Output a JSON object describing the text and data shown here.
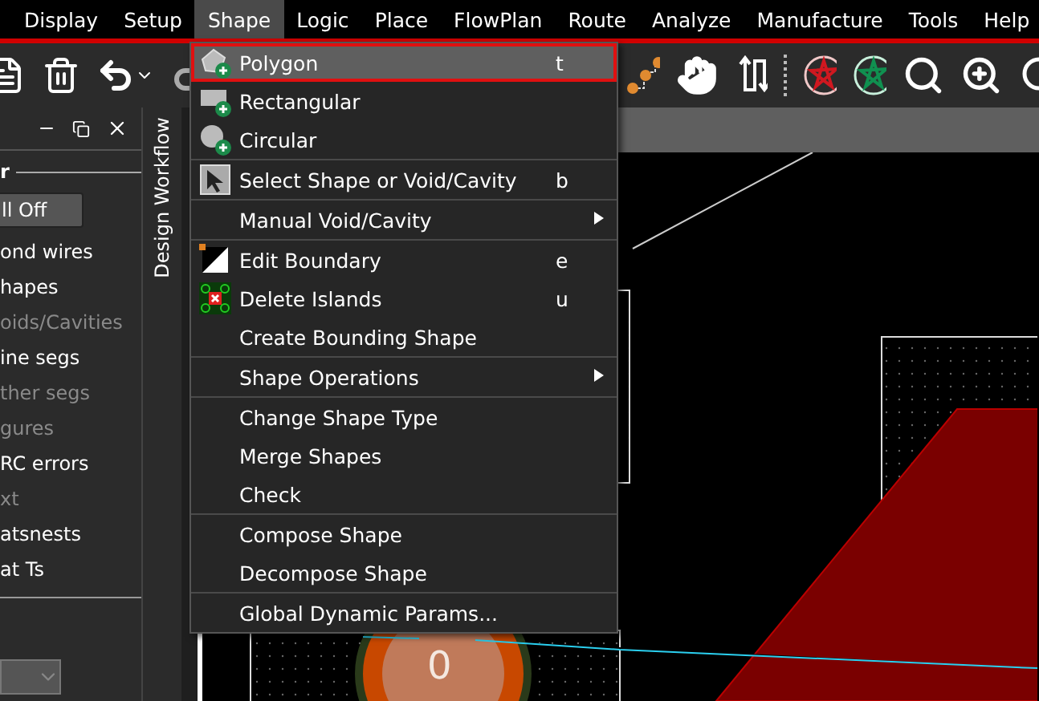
{
  "menubar": [
    {
      "label": "Display",
      "selected": false
    },
    {
      "label": "Setup",
      "selected": false
    },
    {
      "label": "Shape",
      "selected": true
    },
    {
      "label": "Logic",
      "selected": false
    },
    {
      "label": "Place",
      "selected": false
    },
    {
      "label": "FlowPlan",
      "selected": false
    },
    {
      "label": "Route",
      "selected": false
    },
    {
      "label": "Analyze",
      "selected": false
    },
    {
      "label": "Manufacture",
      "selected": false
    },
    {
      "label": "Tools",
      "selected": false
    },
    {
      "label": "Help",
      "selected": false
    }
  ],
  "side_panel": {
    "header": "r",
    "all_off_button": "ll Off",
    "items": [
      {
        "label": "ond wires",
        "enabled": true
      },
      {
        "label": "hapes",
        "enabled": true
      },
      {
        "label": "oids/Cavities",
        "enabled": false
      },
      {
        "label": "ine segs",
        "enabled": true
      },
      {
        "label": "ther segs",
        "enabled": false
      },
      {
        "label": "gures",
        "enabled": false
      },
      {
        "label": "RC errors",
        "enabled": true
      },
      {
        "label": "xt",
        "enabled": false
      },
      {
        "label": "atsnests",
        "enabled": true
      },
      {
        "label": "at Ts",
        "enabled": true
      }
    ]
  },
  "workflow_tab": {
    "label": "Design Workflow"
  },
  "canvas": {
    "pad_label": "0"
  },
  "shape_menu": {
    "groups": [
      [
        {
          "label": "Polygon",
          "shortcut": "t",
          "submenu": false,
          "selected": true
        },
        {
          "label": "Rectangular",
          "submenu": false,
          "selected": false
        },
        {
          "label": "Circular",
          "submenu": false,
          "selected": false
        }
      ],
      [
        {
          "label": "Select Shape or Void/Cavity",
          "shortcut": "b",
          "submenu": false,
          "selected": false
        }
      ],
      [
        {
          "label": "Manual Void/Cavity",
          "submenu": true,
          "selected": false
        }
      ],
      [
        {
          "label": "Edit Boundary",
          "shortcut": "e",
          "submenu": false,
          "selected": false
        },
        {
          "label": "Delete Islands",
          "shortcut": "u",
          "submenu": false,
          "selected": false
        },
        {
          "label": "Create Bounding Shape",
          "submenu": false,
          "selected": false
        }
      ],
      [
        {
          "label": "Shape Operations",
          "submenu": true,
          "selected": false
        }
      ],
      [
        {
          "label": "Change Shape Type",
          "submenu": false,
          "selected": false
        },
        {
          "label": "Merge Shapes",
          "submenu": false,
          "selected": false
        },
        {
          "label": "Check",
          "submenu": false,
          "selected": false
        }
      ],
      [
        {
          "label": "Compose Shape",
          "submenu": false,
          "selected": false
        },
        {
          "label": "Decompose Shape",
          "submenu": false,
          "selected": false
        }
      ],
      [
        {
          "label": "Global Dynamic Params...",
          "submenu": false,
          "selected": false
        }
      ]
    ]
  }
}
